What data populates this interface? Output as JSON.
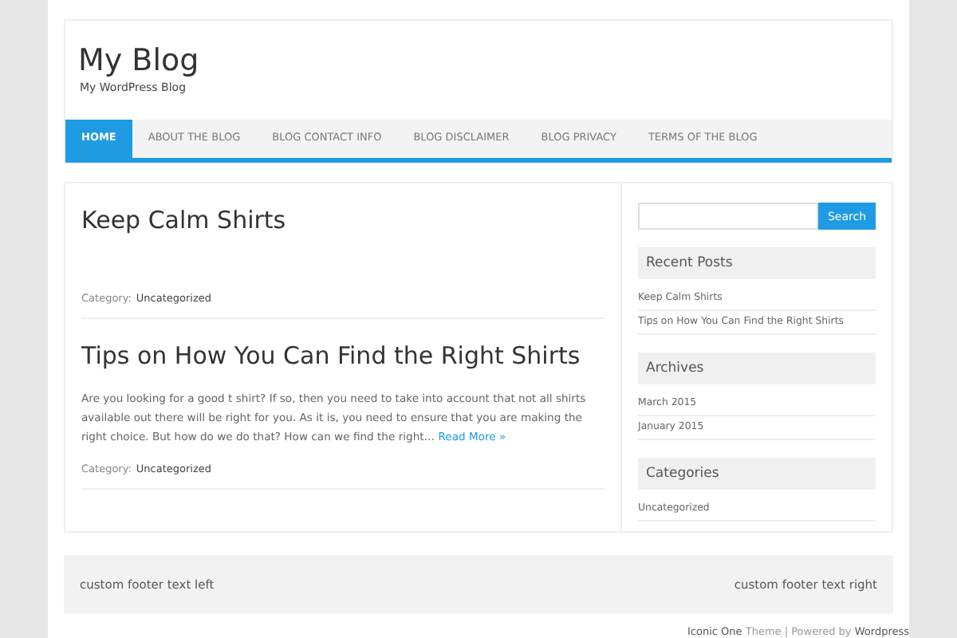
{
  "site": {
    "title": "My Blog",
    "tagline": "My WordPress Blog"
  },
  "nav": [
    {
      "label": "HOME",
      "selected": true
    },
    {
      "label": "ABOUT THE BLOG",
      "selected": false
    },
    {
      "label": "BLOG CONTACT INFO",
      "selected": false
    },
    {
      "label": "BLOG DISCLAIMER",
      "selected": false
    },
    {
      "label": "BLOG PRIVACY",
      "selected": false
    },
    {
      "label": "TERMS OF THE BLOG",
      "selected": false
    }
  ],
  "posts": [
    {
      "title": "Keep Calm Shirts",
      "category_label": "Category:",
      "category": "Uncategorized"
    },
    {
      "title": "Tips on How You Can Find the Right Shirts",
      "excerpt": "Are you looking for a good t shirt? If so, then you need to take into account that not all shirts available out there will be right for you. As it is, you need to ensure that you are making the right choice. But how do we do that? How can we find the right…",
      "read_more": "Read More »",
      "category_label": "Category:",
      "category": "Uncategorized"
    }
  ],
  "sidebar": {
    "search_button": "Search",
    "widgets": [
      {
        "title": "Recent Posts",
        "items": [
          "Keep Calm Shirts",
          "Tips on How You Can Find the Right Shirts"
        ]
      },
      {
        "title": "Archives",
        "items": [
          "March 2015",
          "January 2015"
        ]
      },
      {
        "title": "Categories",
        "items": [
          "Uncategorized"
        ]
      }
    ]
  },
  "footer": {
    "left": "custom footer text left",
    "right": "custom footer text right"
  },
  "credits": {
    "theme_link": "Iconic One",
    "middle": "Theme | Powered by",
    "wp_link": "Wordpress"
  }
}
